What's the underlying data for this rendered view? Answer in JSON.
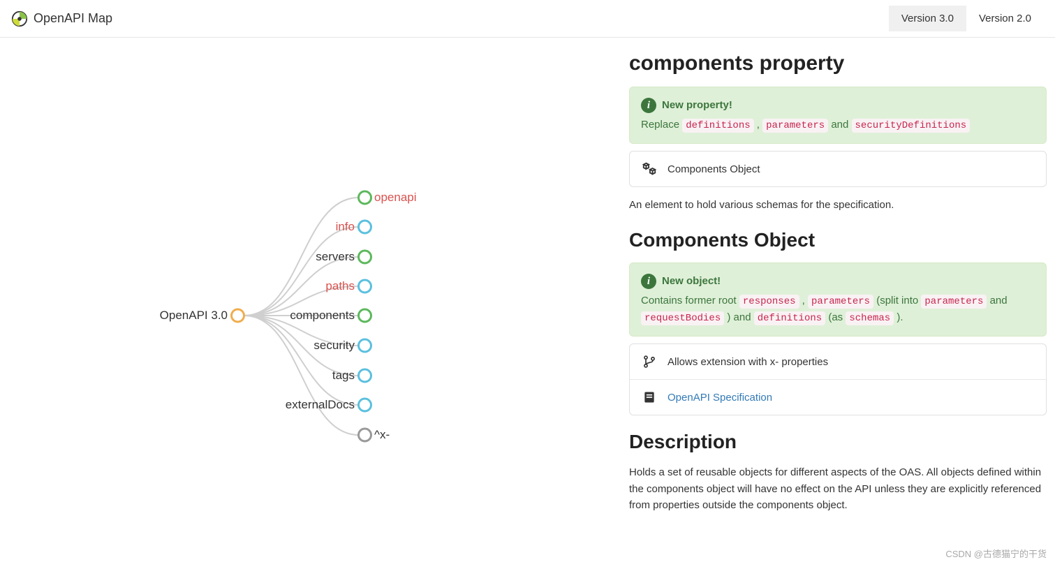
{
  "header": {
    "brand": "OpenAPI Map",
    "tabs": [
      {
        "label": "Version 3.0",
        "active": true
      },
      {
        "label": "Version 2.0",
        "active": false
      }
    ]
  },
  "graph": {
    "root": {
      "label": "OpenAPI 3.0",
      "color": "#f0ad4e",
      "fill": "#fff"
    },
    "children": [
      {
        "label": "openapi",
        "color": "#5cb85c",
        "fill": "#fff",
        "red": true,
        "side": "right"
      },
      {
        "label": "info",
        "color": "#5bc0de",
        "fill": "#d9edf7",
        "red": true,
        "side": "left"
      },
      {
        "label": "servers",
        "color": "#5cb85c",
        "fill": "#5cb85c",
        "red": false,
        "side": "left"
      },
      {
        "label": "paths",
        "color": "#5bc0de",
        "fill": "#d9edf7",
        "red": true,
        "side": "left"
      },
      {
        "label": "components",
        "color": "#5cb85c",
        "fill": "#5cb85c",
        "red": false,
        "side": "left"
      },
      {
        "label": "security",
        "color": "#5bc0de",
        "fill": "#d9edf7",
        "red": false,
        "side": "left"
      },
      {
        "label": "tags",
        "color": "#5bc0de",
        "fill": "#d9edf7",
        "red": false,
        "side": "left"
      },
      {
        "label": "externalDocs",
        "color": "#5bc0de",
        "fill": "#d9edf7",
        "red": false,
        "side": "left"
      },
      {
        "label": "^x-",
        "color": "#999999",
        "fill": "#fff",
        "red": false,
        "side": "right"
      }
    ]
  },
  "detail": {
    "section1_title": "components property",
    "callout1": {
      "title": "New property!",
      "pre": "Replace ",
      "codes": [
        "definitions",
        "parameters",
        "securityDefinitions"
      ],
      "joins": [
        " , ",
        " and ",
        ""
      ]
    },
    "card1": {
      "label": "Components Object"
    },
    "para1": "An element to hold various schemas for the specification.",
    "section2_title": "Components Object",
    "callout2": {
      "title": "New object!",
      "parts": [
        {
          "t": "Contains former root "
        },
        {
          "c": "responses"
        },
        {
          "t": " , "
        },
        {
          "c": "parameters"
        },
        {
          "t": " (split into "
        },
        {
          "c": "parameters"
        },
        {
          "t": " and "
        },
        {
          "c": "requestBodies"
        },
        {
          "t": " ) and "
        },
        {
          "c": "definitions"
        },
        {
          "t": " (as "
        },
        {
          "c": "schemas"
        },
        {
          "t": " )."
        }
      ]
    },
    "card2": {
      "row1": "Allows extension with x- properties",
      "row2": "OpenAPI Specification"
    },
    "section3_title": "Description",
    "para2": "Holds a set of reusable objects for different aspects of the OAS. All objects defined within the components object will have no effect on the API unless they are explicitly referenced from properties outside the components object."
  },
  "watermark": "CSDN @古德猫宁的干货"
}
